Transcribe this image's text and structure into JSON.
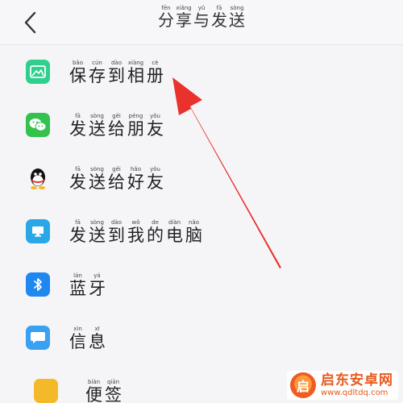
{
  "header": {
    "title_chars": [
      {
        "han": "分",
        "py": "fēn"
      },
      {
        "han": "享",
        "py": "xiǎng"
      },
      {
        "han": "与",
        "py": "yǔ"
      },
      {
        "han": "发",
        "py": "fā"
      },
      {
        "han": "送",
        "py": "sòng"
      }
    ],
    "back_icon": "chevron-left-icon"
  },
  "items": [
    {
      "icon": "album-icon",
      "chars": [
        {
          "han": "保",
          "py": "bǎo"
        },
        {
          "han": "存",
          "py": "cún"
        },
        {
          "han": "到",
          "py": "dào"
        },
        {
          "han": "相",
          "py": "xiàng"
        },
        {
          "han": "册",
          "py": "cè"
        }
      ]
    },
    {
      "icon": "wechat-icon",
      "chars": [
        {
          "han": "发",
          "py": "fā"
        },
        {
          "han": "送",
          "py": "sòng"
        },
        {
          "han": "给",
          "py": "gěi"
        },
        {
          "han": "朋",
          "py": "péng"
        },
        {
          "han": "友",
          "py": "yǒu"
        }
      ]
    },
    {
      "icon": "qq-icon",
      "chars": [
        {
          "han": "发",
          "py": "fā"
        },
        {
          "han": "送",
          "py": "sòng"
        },
        {
          "han": "给",
          "py": "gěi"
        },
        {
          "han": "好",
          "py": "hǎo"
        },
        {
          "han": "友",
          "py": "yǒu"
        }
      ]
    },
    {
      "icon": "computer-icon",
      "chars": [
        {
          "han": "发",
          "py": "fā"
        },
        {
          "han": "送",
          "py": "sòng"
        },
        {
          "han": "到",
          "py": "dào"
        },
        {
          "han": "我",
          "py": "wǒ"
        },
        {
          "han": "的",
          "py": "de"
        },
        {
          "han": "电",
          "py": "diàn"
        },
        {
          "han": "脑",
          "py": "nǎo"
        }
      ]
    },
    {
      "icon": "bluetooth-icon",
      "chars": [
        {
          "han": "蓝",
          "py": "lán"
        },
        {
          "han": "牙",
          "py": "yá"
        }
      ]
    },
    {
      "icon": "message-icon",
      "chars": [
        {
          "han": "信",
          "py": "xìn"
        },
        {
          "han": "息",
          "py": "xī"
        }
      ]
    },
    {
      "icon": "note-icon",
      "chars": [
        {
          "han": "便",
          "py": "biàn"
        },
        {
          "han": "签",
          "py": "qiān"
        }
      ]
    }
  ],
  "watermark": {
    "logo_glyph": "启",
    "name": "启东安卓网",
    "url": "www.qdltdq.com"
  },
  "colors": {
    "annotation_arrow": "#e8322b",
    "album": "#2fcf8d",
    "wechat": "#33c24d",
    "computer": "#2aa7e6",
    "bluetooth": "#1e88f0",
    "message": "#3aa0f2",
    "note": "#f3b92a"
  }
}
